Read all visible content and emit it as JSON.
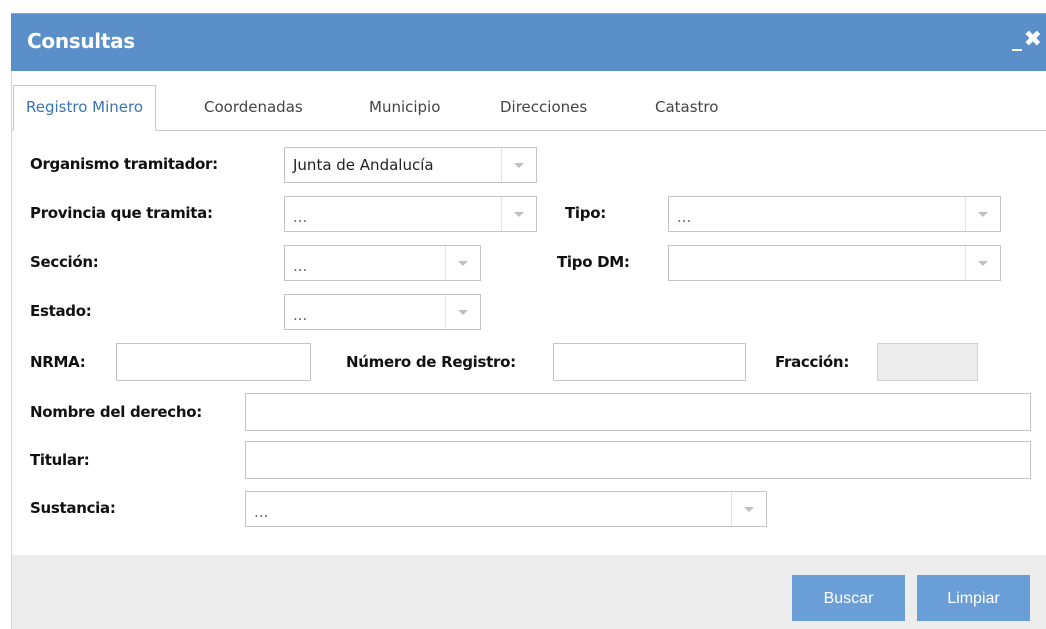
{
  "window": {
    "title": "Consultas",
    "minimize_glyph": "_",
    "close_glyph": "✖",
    "accent_color": "#5a8fc9"
  },
  "tabs": [
    {
      "label": "Registro Minero",
      "active": true
    },
    {
      "label": "Coordenadas",
      "active": false
    },
    {
      "label": "Municipio",
      "active": false
    },
    {
      "label": "Direcciones",
      "active": false
    },
    {
      "label": "Catastro",
      "active": false
    }
  ],
  "form": {
    "organismo": {
      "label": "Organismo tramitador:",
      "value": "Junta de Andalucía"
    },
    "provincia": {
      "label": "Provincia que tramita:",
      "value": "..."
    },
    "tipo": {
      "label": "Tipo:",
      "value": "..."
    },
    "seccion": {
      "label": "Sección:",
      "value": "..."
    },
    "tipo_dm": {
      "label": "Tipo DM:",
      "value": ""
    },
    "estado": {
      "label": "Estado:",
      "value": "..."
    },
    "nrma": {
      "label": "NRMA:",
      "value": ""
    },
    "numero_registro": {
      "label": "Número de Registro:",
      "value": ""
    },
    "fraccion": {
      "label": "Fracción:",
      "value": ""
    },
    "nombre_derecho": {
      "label": "Nombre del derecho:",
      "value": ""
    },
    "titular": {
      "label": "Titular:",
      "value": ""
    },
    "sustancia": {
      "label": "Sustancia:",
      "value": "..."
    }
  },
  "footer": {
    "search_label": "Buscar",
    "clear_label": "Limpiar"
  }
}
